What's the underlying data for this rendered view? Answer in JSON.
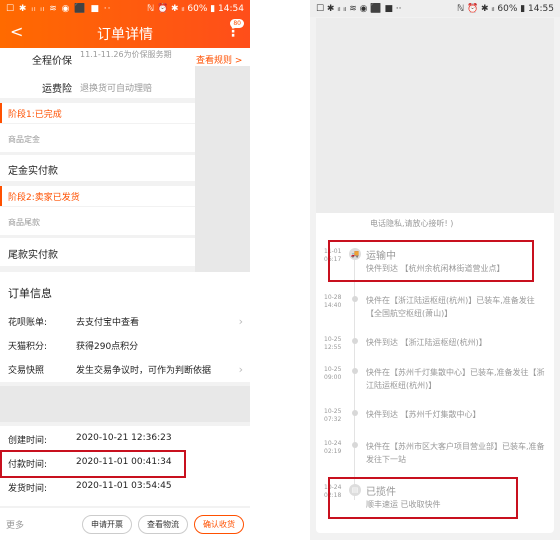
{
  "left": {
    "status": {
      "icons": "☐ ✱ ᵢₗ ᵢₗ ≋ ◉ ⬛ ■ ··",
      "right": "ℕ ⏰ ✱ ᵢₗ 60% ▮ 14:54"
    },
    "header": {
      "title": "订单详情",
      "back": "<",
      "more": "⋮",
      "badge": "80"
    },
    "insurance": {
      "label": "全程价保",
      "value": "11.1-11.26为价保服务期",
      "link": "查看规则 >"
    },
    "shipping": {
      "label": "运费险",
      "value": "退换货可自动理赔"
    },
    "stage1": {
      "label": "阶段1:已完成",
      "sub": "商品定金",
      "paid": "定金实付款"
    },
    "stage2": {
      "label": "阶段2:卖家已发货",
      "sub": "商品尾款",
      "paid": "尾款实付款"
    },
    "order_info": {
      "title": "订单信息",
      "rows": [
        {
          "k": "花呗账单:",
          "v": "去支付宝中查看"
        },
        {
          "k": "天猫积分:",
          "v": "获得290点积分"
        },
        {
          "k": "交易快照",
          "v": "发生交易争议时，可作为判断依据"
        }
      ]
    },
    "times": [
      {
        "k": "创建时间:",
        "v": "2020-10-21 12:36:23"
      },
      {
        "k": "付款时间:",
        "v": "2020-11-01 00:41:34"
      },
      {
        "k": "发货时间:",
        "v": "2020-11-01 03:54:45"
      }
    ],
    "bottom": {
      "more": "更多",
      "invoice": "申请开票",
      "logistics": "查看物流",
      "confirm": "确认收货"
    }
  },
  "right": {
    "status": {
      "icons": "☐ ✱ ᵢₗ ᵢₗ ≋ ◉ ⬛ ■ ··",
      "right": "ℕ ⏰ ✱ ᵢₗ 60% ▮ 14:55"
    },
    "top_text": "电话隐私,请放心接听! )",
    "events": [
      {
        "date": "11-01",
        "time": "06:17",
        "title": "运输中",
        "text": "快件到达 【杭州余杭闲林街道营业点】"
      },
      {
        "date": "10-28",
        "time": "14:40",
        "title": "",
        "text": "快件在【浙江陆运枢纽(杭州)】已装车,准备发往【全国航空枢纽(萧山)】"
      },
      {
        "date": "10-25",
        "time": "12:55",
        "title": "",
        "text": "快件到达 【浙江陆运枢纽(杭州)】"
      },
      {
        "date": "10-25",
        "time": "09:00",
        "title": "",
        "text": "快件在【苏州千灯集散中心】已装车,准备发往【浙江陆运枢纽(杭州)】"
      },
      {
        "date": "10-25",
        "time": "07:32",
        "title": "",
        "text": "快件到达 【苏州千灯集散中心】"
      },
      {
        "date": "10-24",
        "time": "02:19",
        "title": "",
        "text": "快件在【苏州市区大客户项目营业部】已装车,准备发往下一站"
      },
      {
        "date": "10-24",
        "time": "02:18",
        "title": "已揽件",
        "text": "顺丰速运 已收取快件"
      }
    ]
  }
}
